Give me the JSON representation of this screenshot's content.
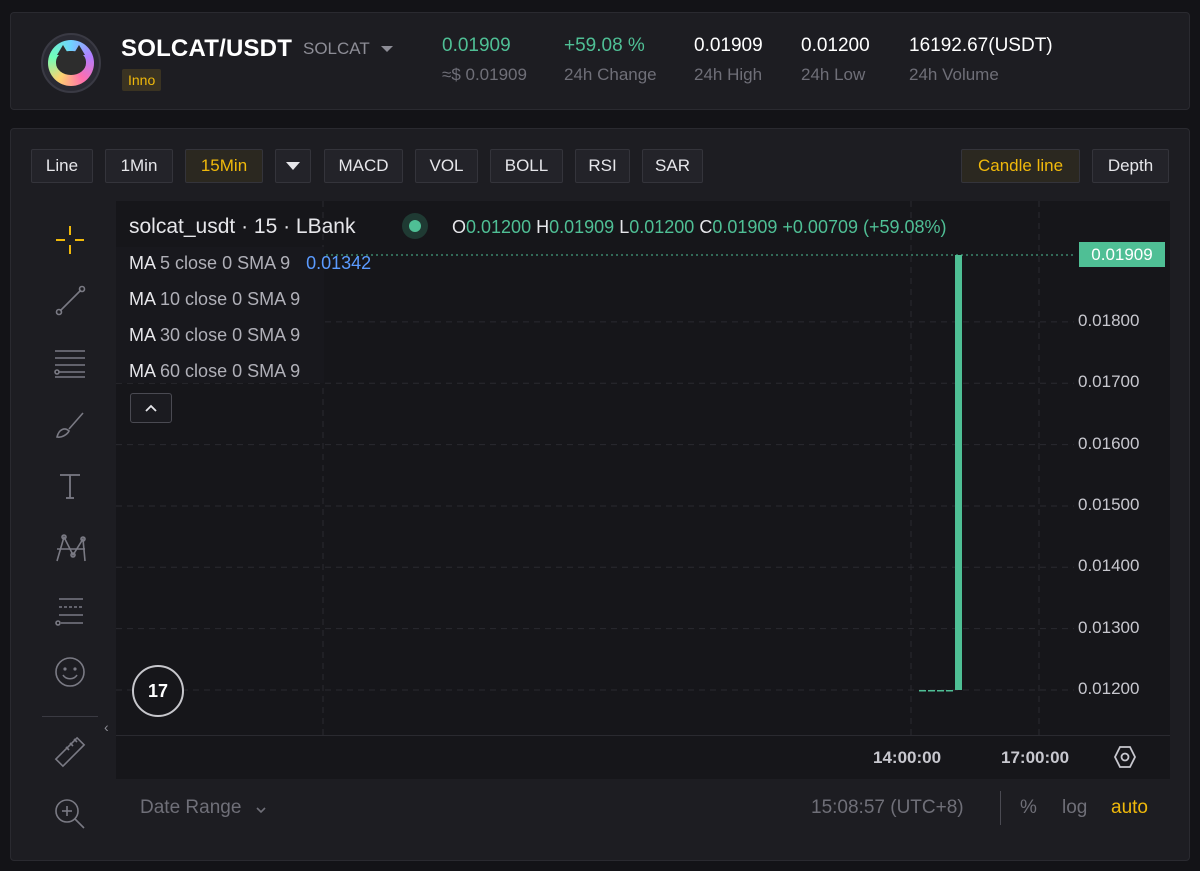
{
  "header": {
    "pair": "SOLCAT/USDT",
    "base": "SOLCAT",
    "tag": "Inno",
    "stats": [
      {
        "value": "0.01909",
        "label": "≈$ 0.01909"
      },
      {
        "value": "+59.08 %",
        "label": "24h Change"
      },
      {
        "value": "0.01909",
        "label": "24h High"
      },
      {
        "value": "0.01200",
        "label": "24h Low"
      },
      {
        "value": "16192.67(USDT)",
        "label": "24h Volume"
      }
    ],
    "accent_green": "#4fbf95",
    "accent_yellow": "#f0b90b"
  },
  "toolbar": {
    "line": "Line",
    "m1": "1Min",
    "m15": "15Min",
    "macd": "MACD",
    "vol": "VOL",
    "boll": "BOLL",
    "rsi": "RSI",
    "sar": "SAR",
    "candle_line": "Candle line",
    "depth": "Depth"
  },
  "tools": [
    "crosshair-icon",
    "trend-line-icon",
    "fib-lines-icon",
    "brush-icon",
    "text-icon",
    "pattern-icon",
    "prediction-icon",
    "emoji-icon",
    "ruler-icon",
    "zoom-in-icon"
  ],
  "chart": {
    "title": "solcat_usdt · 15 · LBank",
    "ohlc": {
      "o_key": "O",
      "o": "0.01200",
      "h_key": "H",
      "h": "0.01909",
      "l_key": "L",
      "l": "0.01200",
      "c_key": "C",
      "c": "0.01909",
      "change": "+0.00709 (+59.08%)"
    },
    "ma": [
      {
        "key": "MA",
        "params": "5 close 0 SMA 9",
        "value": "0.01342"
      },
      {
        "key": "MA",
        "params": "10 close 0 SMA 9",
        "value": ""
      },
      {
        "key": "MA",
        "params": "30 close 0 SMA 9",
        "value": ""
      },
      {
        "key": "MA",
        "params": "60 close 0 SMA 9",
        "value": ""
      }
    ],
    "tv_logo": "17",
    "current_price": "0.01909",
    "price_labels": [
      "0.01800",
      "0.01700",
      "0.01600",
      "0.01500",
      "0.01400",
      "0.01300",
      "0.01200"
    ],
    "time_labels": [
      "14:00:00",
      "17:00:00"
    ]
  },
  "chart_data": {
    "type": "candlestick",
    "candles": [
      {
        "o": 0.012,
        "h": 0.012,
        "l": 0.012,
        "c": 0.012
      },
      {
        "o": 0.012,
        "h": 0.012,
        "l": 0.012,
        "c": 0.012
      },
      {
        "o": 0.012,
        "h": 0.012,
        "l": 0.012,
        "c": 0.012
      },
      {
        "o": 0.012,
        "h": 0.012,
        "l": 0.012,
        "c": 0.012
      },
      {
        "o": 0.012,
        "h": 0.01909,
        "l": 0.012,
        "c": 0.01909
      }
    ],
    "y_ticks": [
      0.018,
      0.017,
      0.016,
      0.015,
      0.014,
      0.013,
      0.012
    ],
    "x_ticks": [
      "14:00:00",
      "17:00:00"
    ],
    "ylim": [
      0.012,
      0.01909
    ],
    "colors": {
      "up": "#4fbf95"
    }
  },
  "footer": {
    "date_range": "Date Range",
    "clock": "15:08:57 (UTC+8)",
    "percent": "%",
    "log": "log",
    "auto": "auto"
  }
}
